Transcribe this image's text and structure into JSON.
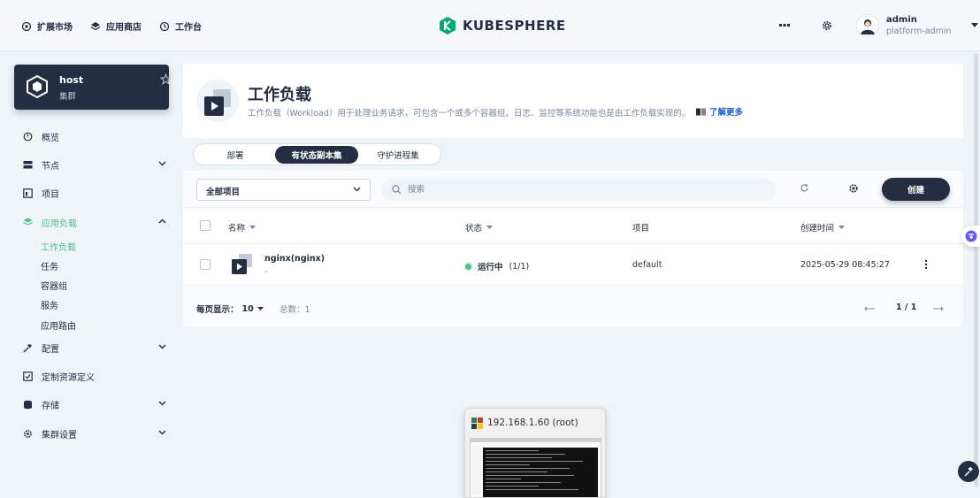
{
  "topbar": {
    "nav": [
      {
        "label": "扩展市场",
        "icon": "extension-icon"
      },
      {
        "label": "应用商店",
        "icon": "app-store-icon"
      },
      {
        "label": "工作台",
        "icon": "workbench-icon"
      }
    ],
    "brand": "KUBESPHERE",
    "user": {
      "name": "admin",
      "role": "platform-admin"
    }
  },
  "cluster": {
    "name": "host",
    "type": "集群"
  },
  "sidebar": {
    "items": [
      {
        "label": "概览"
      },
      {
        "label": "节点"
      },
      {
        "label": "项目"
      },
      {
        "label": "应用负载"
      },
      {
        "label": "配置"
      },
      {
        "label": "定制资源定义"
      },
      {
        "label": "存储"
      },
      {
        "label": "集群设置"
      }
    ],
    "workload_sub": [
      {
        "label": "工作负载"
      },
      {
        "label": "任务"
      },
      {
        "label": "容器组"
      },
      {
        "label": "服务"
      },
      {
        "label": "应用路由"
      }
    ]
  },
  "page": {
    "title": "工作负载",
    "description": "工作负载（Workload）用于处理业务请求，可包含一个或多个容器组。日志、监控等系统功能也是由工作负载实现的。",
    "learn_more": "了解更多"
  },
  "tabs": [
    {
      "label": "部署"
    },
    {
      "label": "有状态副本集"
    },
    {
      "label": "守护进程集"
    }
  ],
  "toolbar": {
    "project_select": "全部项目",
    "search_placeholder": "搜索",
    "create_label": "创建"
  },
  "table": {
    "headers": {
      "name": "名称",
      "status": "状态",
      "project": "项目",
      "created": "创建时间"
    },
    "rows": [
      {
        "name": "nginx(nginx)",
        "sub": "-",
        "status": "运行中",
        "status_count": "(1/1)",
        "project": "default",
        "created": "2025-05-29 08:45:27"
      }
    ]
  },
  "footer": {
    "per_page_label": "每页显示：",
    "per_page_value": "10",
    "total": "总数：1",
    "page_indicator": "1 / 1"
  },
  "preview": {
    "title": "192.168.1.60 (root)"
  },
  "colors": {
    "accent": "#55bc8a",
    "dark": "#242e42",
    "link": "#3385ff"
  }
}
